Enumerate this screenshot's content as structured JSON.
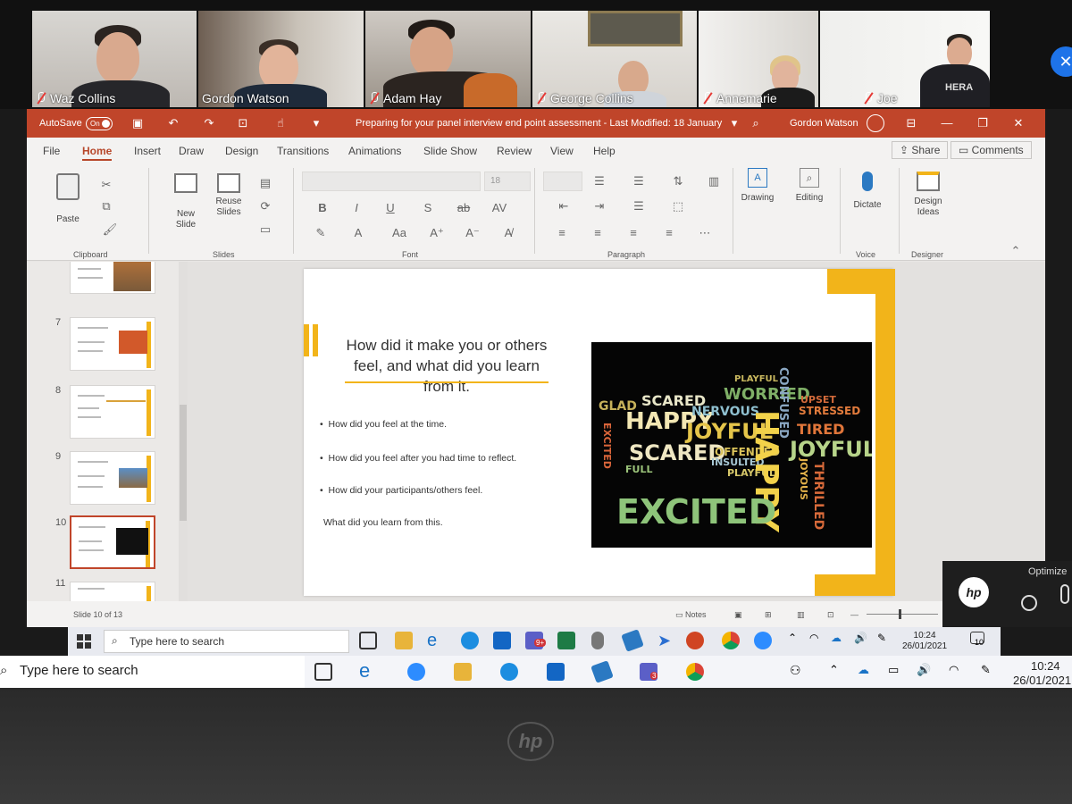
{
  "participants": [
    {
      "name": "Waz Collins"
    },
    {
      "name": "Gordon Watson"
    },
    {
      "name": "Adam Hay"
    },
    {
      "name": "George Collins"
    },
    {
      "name": "Annemarie"
    },
    {
      "name": "Joe",
      "shirt_text": "HERA"
    }
  ],
  "titlebar": {
    "autosave_label": "AutoSave",
    "autosave_state": "On",
    "doc_title": "Preparing for your panel interview end point assessment  -  Last Modified: 18 January",
    "user": "Gordon Watson"
  },
  "tabs": [
    "File",
    "Home",
    "Insert",
    "Draw",
    "Design",
    "Transitions",
    "Animations",
    "Slide Show",
    "Review",
    "View",
    "Help"
  ],
  "share_label": "Share",
  "comments_label": "Comments",
  "ribbon": {
    "paste": "Paste",
    "clipboard": "Clipboard",
    "new_slide": "New Slide",
    "reuse_slides": "Reuse Slides",
    "slides": "Slides",
    "font_size": "18",
    "font": "Font",
    "paragraph": "Paragraph",
    "drawing": "Drawing",
    "editing": "Editing",
    "dictate": "Dictate",
    "voice": "Voice",
    "design_ideas": "Design Ideas",
    "designer": "Designer"
  },
  "thumbnails": [
    {
      "num": "7"
    },
    {
      "num": "8"
    },
    {
      "num": "9"
    },
    {
      "num": "10"
    },
    {
      "num": "11"
    }
  ],
  "slide": {
    "title": "How did it make you or others feel, and what did you learn from it.",
    "bullets": [
      "How did you feel at the time.",
      "How did you feel after you had time to reflect.",
      "How did your participants/others feel."
    ],
    "footer_text": "What did you learn from this."
  },
  "wordcloud": {
    "big_words": [
      "GLAD",
      "SCARED",
      "WORRIED",
      "PLAYFUL",
      "CONFUSED",
      "HAPPY",
      "NERVOUS",
      "JOYFUL",
      "UPSET",
      "STRESSED",
      "EXCITED",
      "SCARED",
      "OFFENDED",
      "TIRED",
      "INSULTED",
      "JOYFUL",
      "FULL",
      "PLAYFUL",
      "HAPPY",
      "EXCITED",
      "THRILLED",
      "JOYOUS"
    ]
  },
  "statusbar": {
    "slide_count": "Slide 10 of 13",
    "notes": "Notes"
  },
  "taskbar_inner": {
    "search_placeholder": "Type here to search",
    "time": "10:24",
    "date": "26/01/2021",
    "notification_count": "10",
    "teams_badge": "9+"
  },
  "taskbar_outer": {
    "search_placeholder": "Type here to search",
    "time": "10:24",
    "date": "26/01/2021",
    "teams_badge": "3"
  },
  "hp_popup": {
    "label": "Optimize"
  },
  "colors": {
    "ppt_accent": "#c0452a",
    "slide_accent": "#f2b41a"
  }
}
